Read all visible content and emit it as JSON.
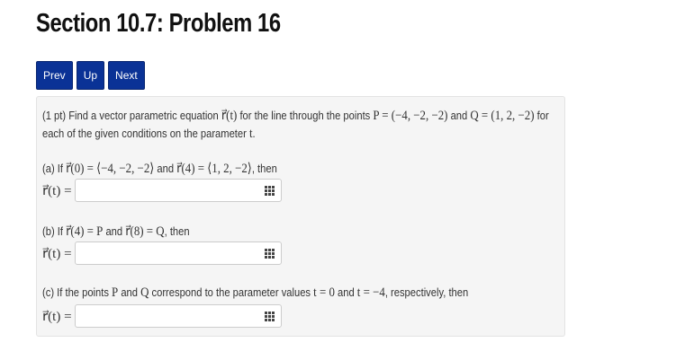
{
  "page_title": "Section 10.7: Problem 16",
  "nav": {
    "prev": "Prev",
    "up": "Up",
    "next": "Next"
  },
  "problem": {
    "intro_a": "(1 pt) Find a vector parametric equation ",
    "r_of_t": "r⃗(t)",
    "intro_b": " for the line through the points ",
    "P_def": "P = (−4, −2, −2)",
    "and": " and ",
    "Q_def": "Q = (1, 2, −2)",
    "intro_c": " for each of the given conditions on the parameter ",
    "t": "t",
    "period": ".",
    "parts": [
      {
        "label_a": "(a) If ",
        "m1": "r⃗(0) = ⟨−4, −2, −2⟩",
        "label_b": " and ",
        "m2": "r⃗(4) = ⟨1, 2, −2⟩",
        "label_c": ", then",
        "answer_label": "r⃗(t) =",
        "answer_value": ""
      },
      {
        "label_a": "(b) If ",
        "m1": "r⃗(4) = P",
        "label_b": " and ",
        "m2": "r⃗(8) = Q",
        "label_c": ", then",
        "answer_label": "r⃗(t) =",
        "answer_value": ""
      },
      {
        "label_a": "(c) If the points ",
        "m1": "P",
        "label_b": " and ",
        "m2": "Q",
        "label_c": " correspond to the parameter values ",
        "m3": "t = 0",
        "label_d": " and ",
        "m4": "t = −4",
        "label_e": ", respectively, then",
        "answer_label": "r⃗(t) =",
        "answer_value": ""
      }
    ]
  },
  "icons": {
    "answer_tool": "keypad-grid-icon"
  },
  "colors": {
    "nav_button": "#0a3296",
    "panel_bg": "#f5f5f5"
  }
}
